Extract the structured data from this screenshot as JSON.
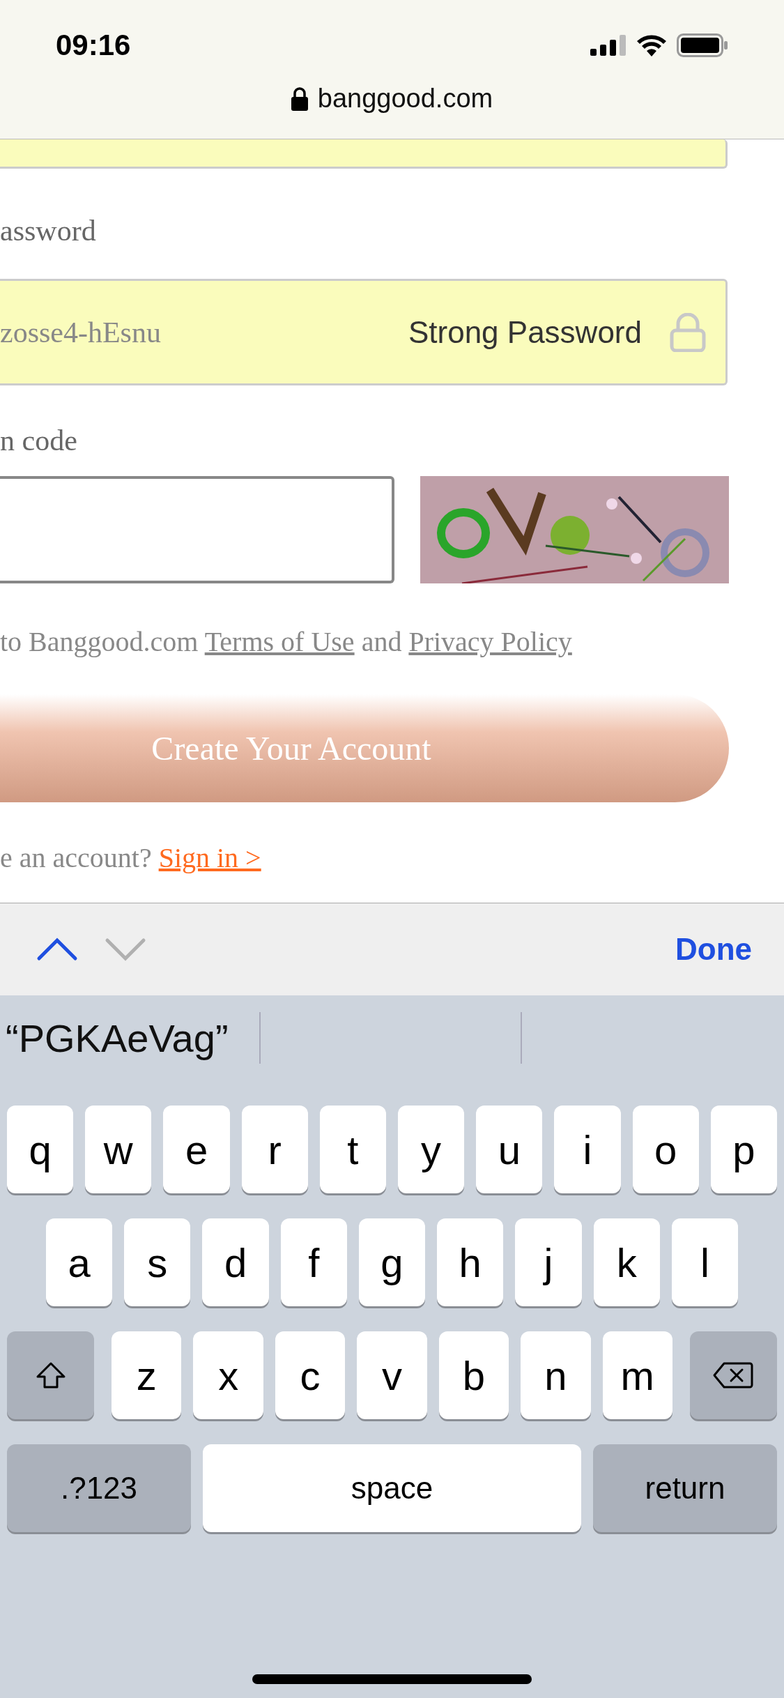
{
  "status_bar": {
    "time": "09:16"
  },
  "browser": {
    "url": "banggood.com"
  },
  "form": {
    "password_label": "assword",
    "password_value": "zosse4-hEsnu",
    "password_hint": "Strong Password",
    "code_label": "n code",
    "terms": {
      "prefix": "to Banggood.com",
      "terms_link": "Terms of Use",
      "middle": "and",
      "privacy_link": "Privacy Policy"
    },
    "create_button": "Create Your Account",
    "signin": {
      "prompt": "e an account?",
      "link": "Sign in >"
    }
  },
  "keyboard_toolbar": {
    "previous_disabled": false,
    "next_disabled": true,
    "done": "Done"
  },
  "keyboard": {
    "suggestions": [
      "“PGKAeVag”"
    ],
    "rows": [
      [
        {
          "kind": "letter",
          "label": "q"
        },
        {
          "kind": "letter",
          "label": "w"
        },
        {
          "kind": "letter",
          "label": "e"
        },
        {
          "kind": "letter",
          "label": "r"
        },
        {
          "kind": "letter",
          "label": "t"
        },
        {
          "kind": "letter",
          "label": "y"
        },
        {
          "kind": "letter",
          "label": "u"
        },
        {
          "kind": "letter",
          "label": "i"
        },
        {
          "kind": "letter",
          "label": "o"
        },
        {
          "kind": "letter",
          "label": "p"
        }
      ],
      [
        {
          "kind": "letter",
          "label": "a"
        },
        {
          "kind": "letter",
          "label": "s"
        },
        {
          "kind": "letter",
          "label": "d"
        },
        {
          "kind": "letter",
          "label": "f"
        },
        {
          "kind": "letter",
          "label": "g"
        },
        {
          "kind": "letter",
          "label": "h"
        },
        {
          "kind": "letter",
          "label": "j"
        },
        {
          "kind": "letter",
          "label": "k"
        },
        {
          "kind": "letter",
          "label": "l"
        }
      ],
      [
        {
          "kind": "shift"
        },
        {
          "kind": "letter",
          "label": "z"
        },
        {
          "kind": "letter",
          "label": "x"
        },
        {
          "kind": "letter",
          "label": "c"
        },
        {
          "kind": "letter",
          "label": "v"
        },
        {
          "kind": "letter",
          "label": "b"
        },
        {
          "kind": "letter",
          "label": "n"
        },
        {
          "kind": "letter",
          "label": "m"
        },
        {
          "kind": "delete"
        }
      ]
    ],
    "bottom_keys": [
      {
        "kind": "mode",
        "label": ".?123"
      },
      {
        "kind": "space",
        "label": "space"
      },
      {
        "kind": "return",
        "label": "return"
      }
    ]
  }
}
